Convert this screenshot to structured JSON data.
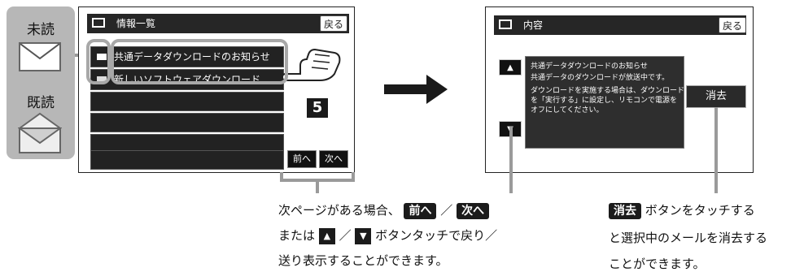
{
  "legend": {
    "unread_label": "未読",
    "read_label": "既読"
  },
  "left_screen": {
    "title": "情報一覧",
    "back_label": "戻る",
    "items": [
      {
        "title": "共通データダウンロードのお知らせ",
        "status": "unread"
      },
      {
        "title": "新しいソフトウェアダウンロード…",
        "status": "read"
      }
    ],
    "prev_label": "前へ",
    "next_label": "次へ",
    "step_badge": "5"
  },
  "right_screen": {
    "title": "内容",
    "back_label": "戻る",
    "detail_lines": [
      "共通データダウンロードのお知らせ",
      "共通データのダウンロードが放送中です。",
      "ダウンロードを実施する場合は、ダウンロード",
      "を「実行する」に設定し、リモコンで電源を",
      "オフにしてください。"
    ],
    "up_arrow": "▲",
    "down_arrow": "▼",
    "delete_label": "消去"
  },
  "captions": {
    "left_part1": "次ページがある場合、",
    "left_prev": "前へ",
    "slash": "／",
    "left_next": "次へ",
    "left_line2_prefix": "または",
    "left_up": "▲",
    "left_down": "▼",
    "left_line2_suffix": "ボタンタッチで戻り／",
    "left_line3": "送り表示することができます。",
    "right_delete": "消去",
    "right_line1_suffix": "ボタンをタッチする",
    "right_line2": "と選択中のメールを消去する",
    "right_line3": "ことができます。"
  },
  "icons": {
    "unread": "envelope-closed-icon",
    "read": "envelope-open-icon",
    "hand": "pointing-hand-icon",
    "screen_title": "monitor-icon",
    "flow_arrow": "right-arrow-icon"
  }
}
